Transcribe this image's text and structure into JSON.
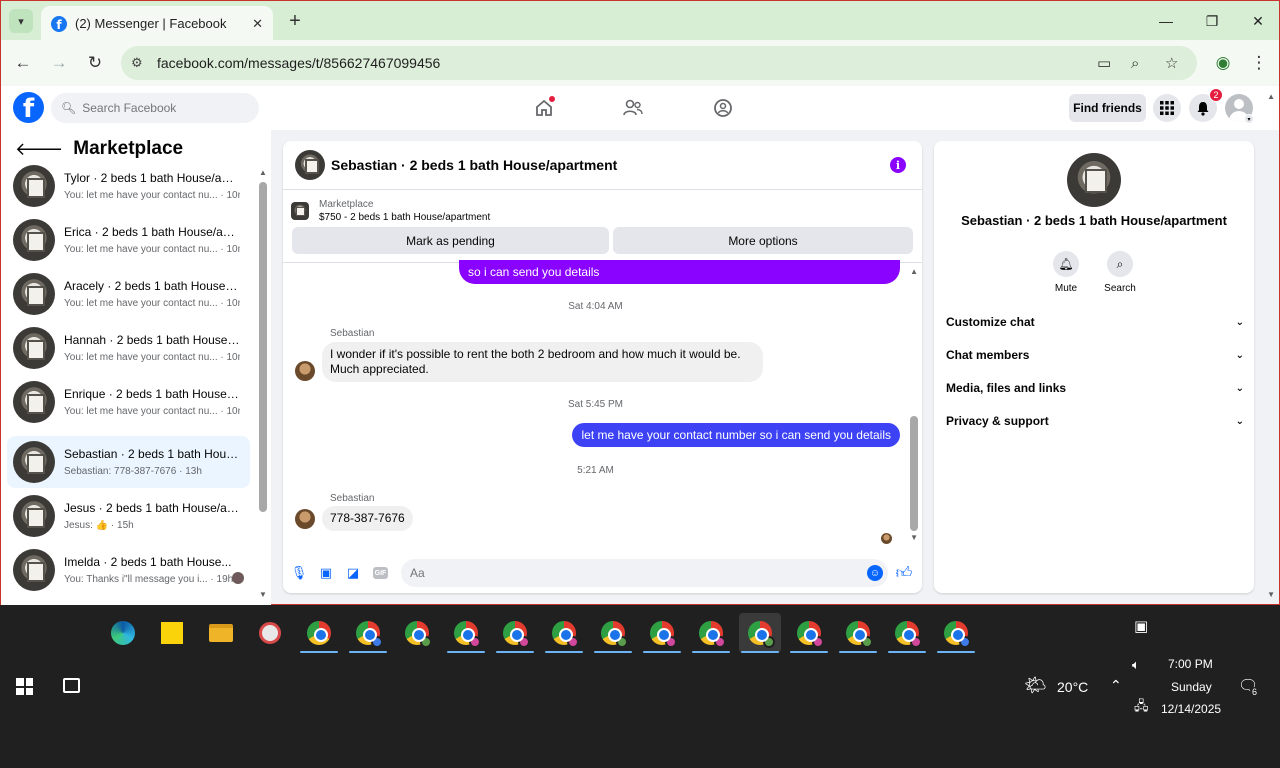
{
  "browser": {
    "tab_title": "(2) Messenger | Facebook",
    "url": "facebook.com/messages/t/856627467099456"
  },
  "fb": {
    "search_placeholder": "Search Facebook",
    "find_friends": "Find friends",
    "notifications_count": "2"
  },
  "marketplace": {
    "title": "Marketplace",
    "conversations": [
      {
        "name": "Tylor · 2 beds 1 bath House/apa...",
        "preview": "You: let me have your contact nu... · 10m"
      },
      {
        "name": "Erica · 2 beds 1 bath House/apa...",
        "preview": "You: let me have your contact nu... · 10m"
      },
      {
        "name": "Aracely · 2 beds 1 bath House/a...",
        "preview": "You: let me have your contact nu... · 10m"
      },
      {
        "name": "Hannah · 2 beds 1 bath House/...",
        "preview": "You: let me have your contact nu... · 10m"
      },
      {
        "name": "Enrique · 2 beds 1 bath House/a...",
        "preview": "You: let me have your contact nu... · 10m"
      },
      {
        "name": "Sebastian · 2 beds 1 bath House...",
        "preview": "Sebastian: 778-387-7676 · 13h"
      },
      {
        "name": "Jesus · 2 beds 1 bath House/apa...",
        "preview": "Jesus: 👍 · 15h"
      },
      {
        "name": "Imelda · 2 beds 1 bath House...",
        "preview": "You: Thanks i\"ll message you i... · 19h"
      }
    ]
  },
  "chat": {
    "title": "Sebastian · 2 beds 1 bath House/apartment",
    "listing_label": "Marketplace",
    "listing_title": "$750 - 2 beds 1 bath House/apartment",
    "mark_pending": "Mark as pending",
    "more_options": "More options",
    "messages": {
      "out_1": "so i can send you details",
      "time_1": "Sat 4:04 AM",
      "sender_1": "Sebastian",
      "in_1": "I wonder if it's possible to rent the both 2 bedroom and how much it would be. Much appreciated.",
      "time_2": "Sat 5:45 PM",
      "out_2": "let me have your contact number so i can send you details",
      "time_3": "5:21 AM",
      "sender_2": "Sebastian",
      "in_2": "778-387-7676"
    },
    "composer_placeholder": "Aa",
    "gif_label": "GIF"
  },
  "details": {
    "name": "Sebastian · 2 beds 1 bath House/apartment",
    "mute": "Mute",
    "search": "Search",
    "sections": [
      "Customize chat",
      "Chat members",
      "Media, files and links",
      "Privacy & support"
    ]
  },
  "taskbar": {
    "temperature": "20°C",
    "time": "7:00 PM",
    "day": "Sunday",
    "date": "12/14/2025",
    "notification_count": "6"
  },
  "colors": {
    "fb_blue": "#0866ff",
    "outgoing_purple": "#8a02ff",
    "outgoing_blue": "#3d43f5",
    "tab_bar": "#d7eed5"
  }
}
